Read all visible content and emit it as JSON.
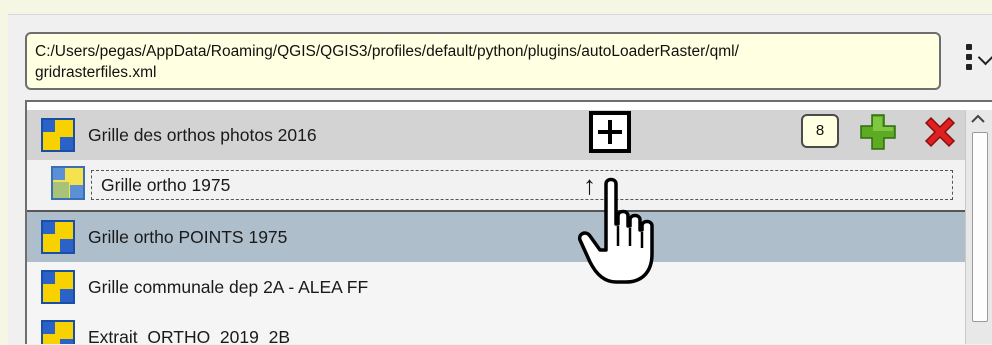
{
  "config_path": {
    "line1": "C:/Users/pegas/AppData/Roaming/QGIS/QGIS3/profiles/default/python/plugins/autoLoaderRaster/qml/",
    "line2": "gridrasterfiles.xml"
  },
  "menu": {
    "icon": "vertical-dots-menu-icon"
  },
  "list": {
    "items": [
      {
        "label": "Grille des orthos photos 2016",
        "icon": "raster-grid-icon",
        "state": "normal"
      },
      {
        "label": "Grille ortho 1975",
        "icon": "raster-grid-icon",
        "state": "dragging"
      },
      {
        "label": "Grille ortho POINTS 1975",
        "icon": "raster-grid-icon",
        "state": "selected"
      },
      {
        "label": "Grille communale dep 2A -  ALEA FF",
        "icon": "raster-grid-icon",
        "state": "normal"
      },
      {
        "label": "Extrait_ORTHO_2019_2B",
        "icon": "raster-grid-icon",
        "state": "normal"
      }
    ],
    "count": "8"
  },
  "actions": {
    "add_icon": "green-plus-icon",
    "delete_icon": "red-cross-icon",
    "drop_indicator": "boxed-plus-icon",
    "drag_arrow": "↑",
    "cursor": "hand-pointer-icon"
  },
  "colors": {
    "path_background": "#ffffe1",
    "selected_row": "#aebecb",
    "add": "#4a9a1a",
    "delete": "#d81c1c"
  }
}
